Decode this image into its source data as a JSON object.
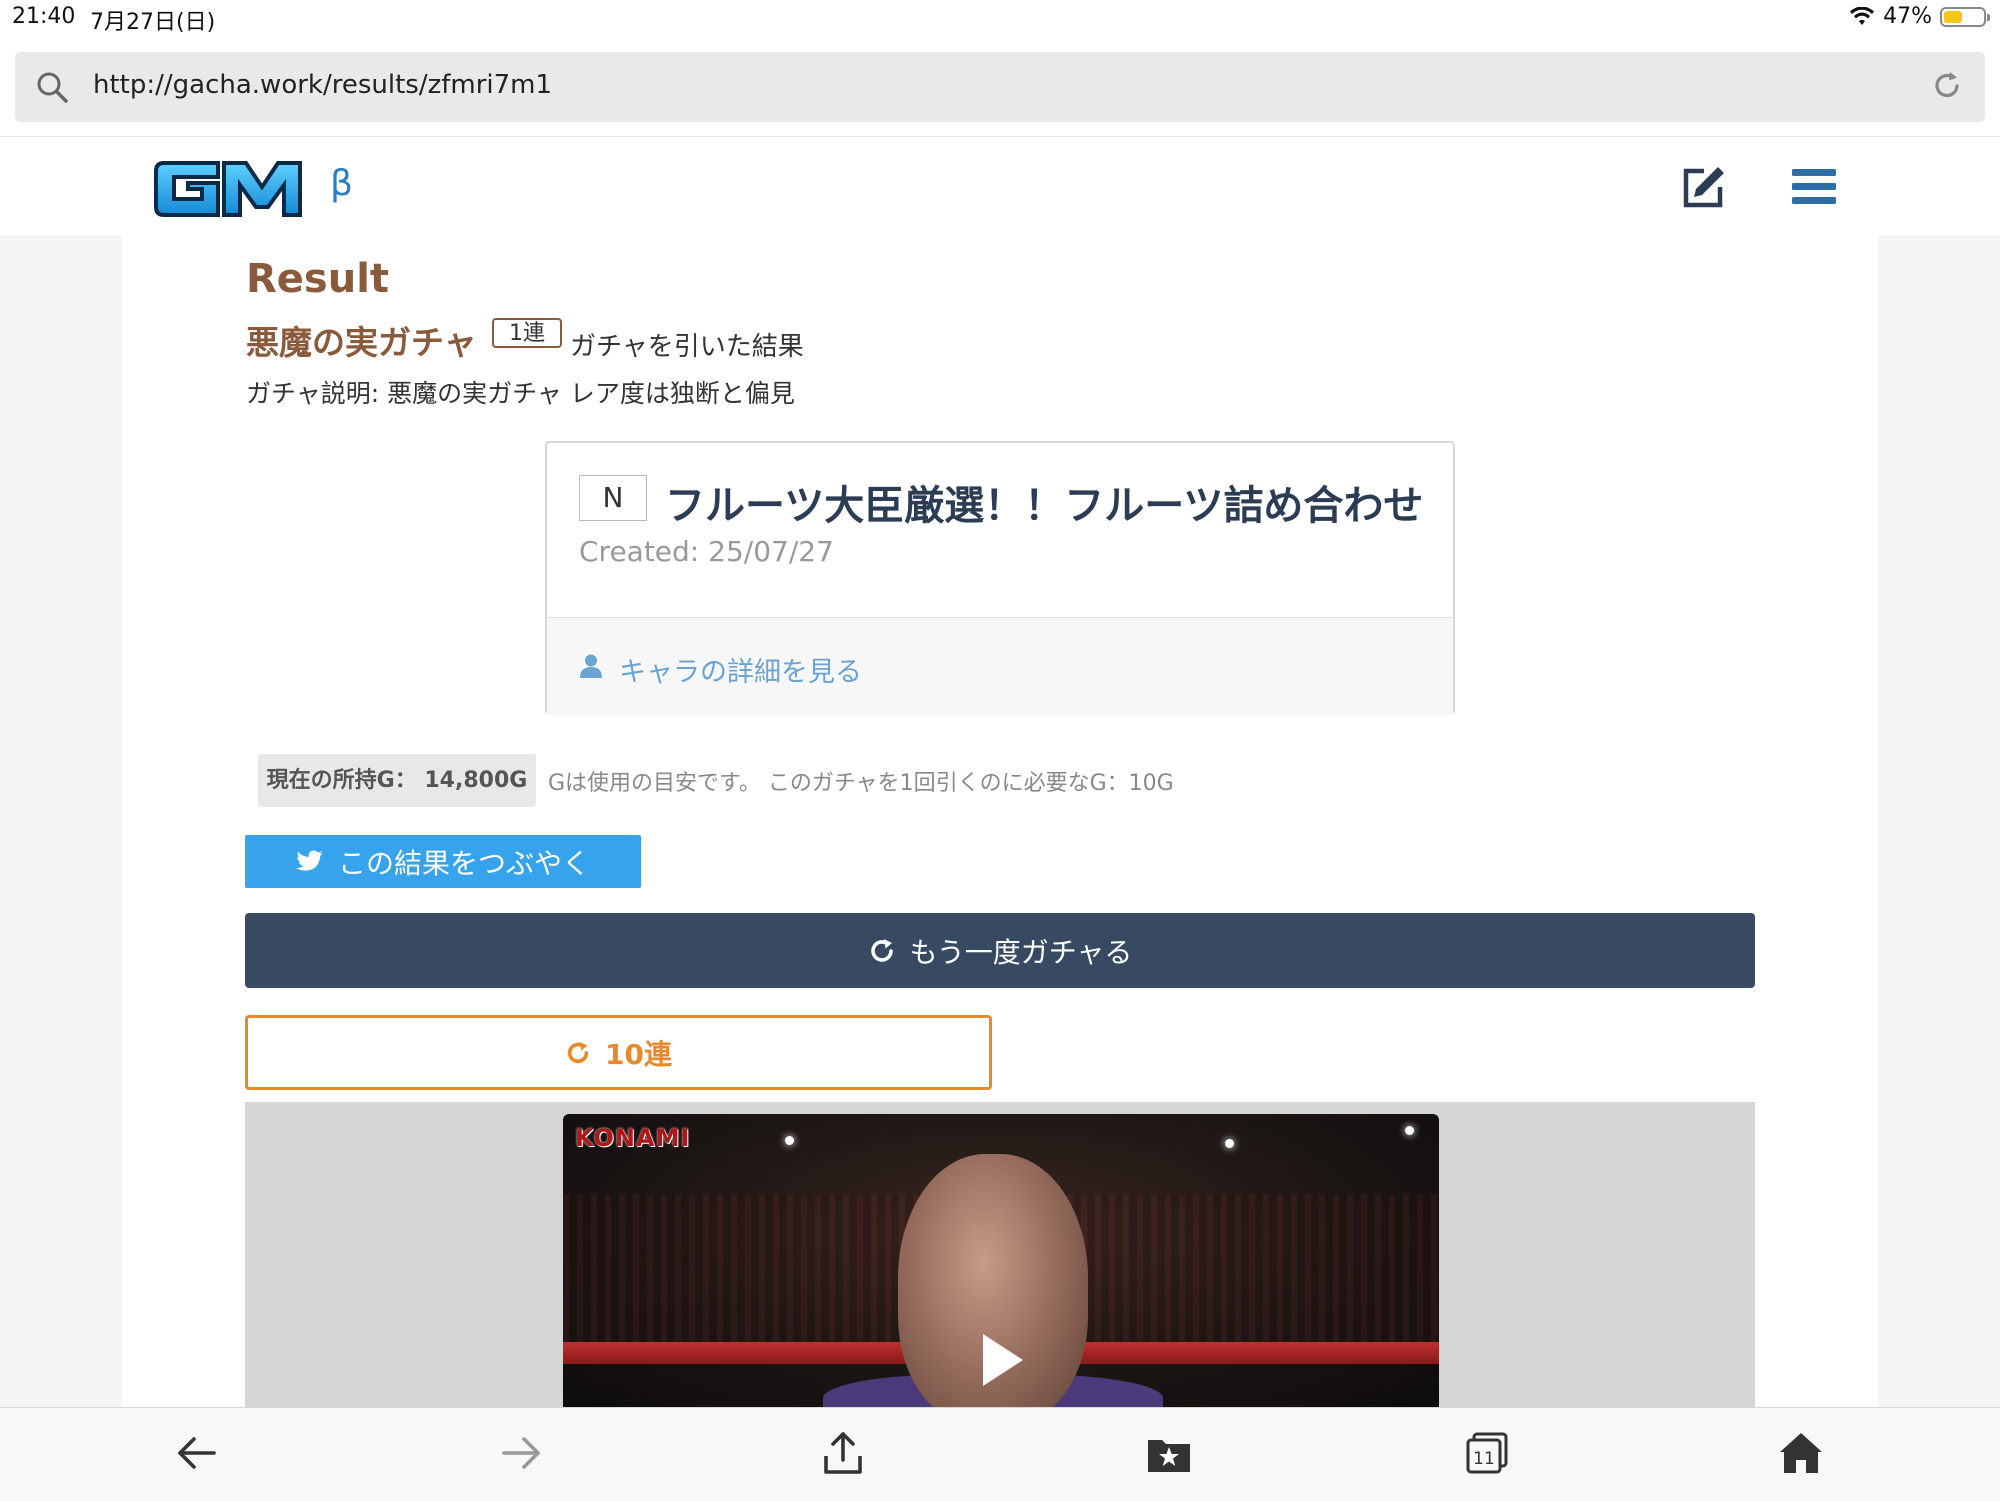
{
  "status_bar": {
    "time": "21:40",
    "date": "7月27日(日)",
    "battery": "47%",
    "battery_level": 0.47,
    "battery_color": "#f5c518"
  },
  "browser": {
    "url": "http://gacha.work/results/zfmri7m1",
    "tab_count": "11"
  },
  "header": {
    "logo_text": "GM",
    "logo_beta": "β"
  },
  "result": {
    "heading": "Result",
    "gacha_name": "悪魔の実ガチャ",
    "draw_badge": "1連",
    "suffix": "ガチャを引いた結果",
    "description": "ガチャ説明: 悪魔の実ガチャ レア度は独断と偏見"
  },
  "card": {
    "rarity": "N",
    "title": "フルーツ大臣厳選！！フルーツ詰め合わせ",
    "created": "Created: 25/07/27",
    "detail_link": "キャラの詳細を見る"
  },
  "coins": {
    "label": "現在の所持G： 14,800G",
    "note": "Gは使用の目安です。 このガチャを1回引くのに必要なG：10G"
  },
  "buttons": {
    "tweet": "この結果をつぶやく",
    "again": "もう一度ガチャる",
    "ten": "10連"
  },
  "video": {
    "brand": "KONAMI"
  },
  "colors": {
    "accent_brown": "#8a5a3c",
    "card_title": "#2b3d55",
    "link_blue": "#6aa3d4",
    "twitter_blue": "#36a3ec",
    "again_navy": "#384a62",
    "ten_orange": "#e78a2c"
  },
  "icons": {
    "url_search": "search-icon",
    "url_reload": "reload-icon",
    "header_edit": "edit-icon",
    "header_menu": "hamburger-menu-icon",
    "detail": "user-icon",
    "tweet": "twitter-bird-icon",
    "again": "refresh-icon",
    "ten": "refresh-icon",
    "toolbar": [
      "back-arrow-icon",
      "forward-arrow-icon",
      "share-icon",
      "bookmarks-icon",
      "tabs-icon",
      "home-icon"
    ]
  }
}
